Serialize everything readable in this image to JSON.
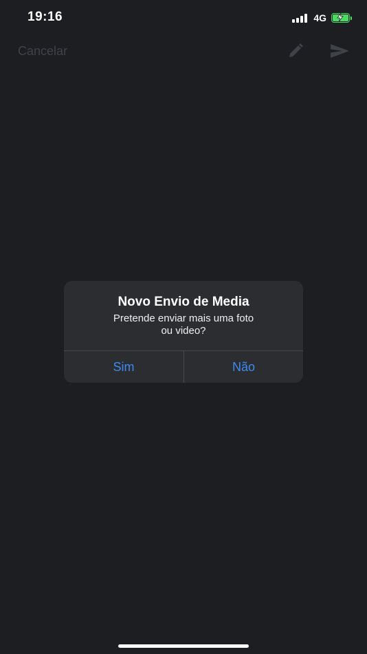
{
  "status_bar": {
    "time": "19:16",
    "network": "4G",
    "battery_color": "#4cd964"
  },
  "nav": {
    "cancel_label": "Cancelar",
    "edit_icon": "pencil-icon",
    "send_icon": "send-icon"
  },
  "dialog": {
    "title": "Novo Envio de Media",
    "message_line1": "Pretende enviar mais uma foto",
    "message_line2": "ou video?",
    "yes_label": "Sim",
    "no_label": "Não",
    "button_color": "#3d8bf0"
  }
}
